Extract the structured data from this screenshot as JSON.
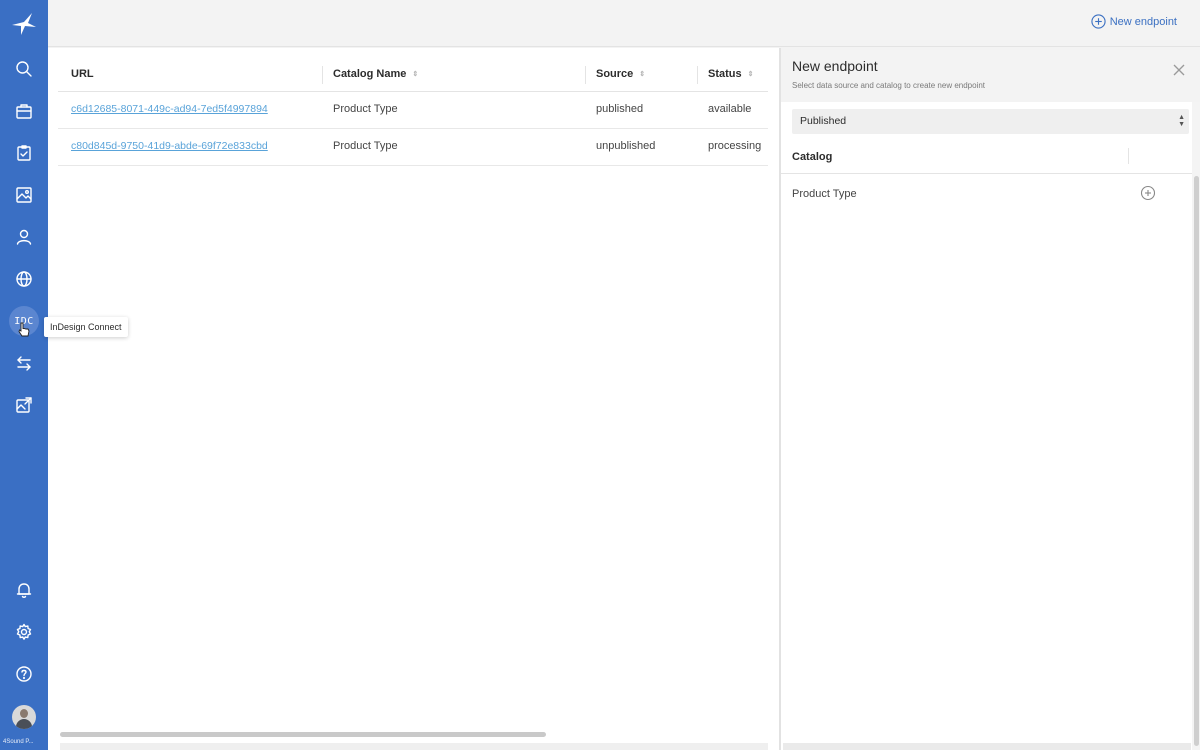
{
  "sidebar": {
    "icons": [
      {
        "name": "app-logo"
      },
      {
        "name": "search-icon"
      },
      {
        "name": "briefcase-icon"
      },
      {
        "name": "clipboard-check-icon"
      },
      {
        "name": "image-icon"
      },
      {
        "name": "user-icon"
      },
      {
        "name": "globe-icon"
      },
      {
        "name": "transfer-arrows-icon"
      },
      {
        "name": "image-export-icon"
      },
      {
        "name": "bell-icon"
      },
      {
        "name": "gear-icon"
      },
      {
        "name": "help-icon"
      }
    ],
    "active_item": {
      "badge": "IDC",
      "tooltip": "InDesign Connect"
    },
    "workspace_label": "4Sound P..."
  },
  "topbar": {
    "new_endpoint_label": "New endpoint"
  },
  "table": {
    "columns": [
      {
        "label": "URL",
        "sortable": false
      },
      {
        "label": "Catalog Name",
        "sortable": true
      },
      {
        "label": "Source",
        "sortable": true
      },
      {
        "label": "Status",
        "sortable": true
      }
    ],
    "rows": [
      {
        "url": "c6d12685-8071-449c-ad94-7ed5f4997894",
        "catalog": "Product Type",
        "source": "published",
        "status": "available"
      },
      {
        "url": "c80d845d-9750-41d9-abde-69f72e833cbd",
        "catalog": "Product Type",
        "source": "unpublished",
        "status": "processing"
      }
    ]
  },
  "panel": {
    "title": "New endpoint",
    "subtitle": "Select data source and catalog to create new endpoint",
    "source_select_value": "Published",
    "catalog_header": "Catalog",
    "catalog_items": [
      "Product Type"
    ]
  },
  "colors": {
    "sidebar": "#3a6fc4",
    "accent": "#3b70c2",
    "link": "#59a3d9"
  }
}
